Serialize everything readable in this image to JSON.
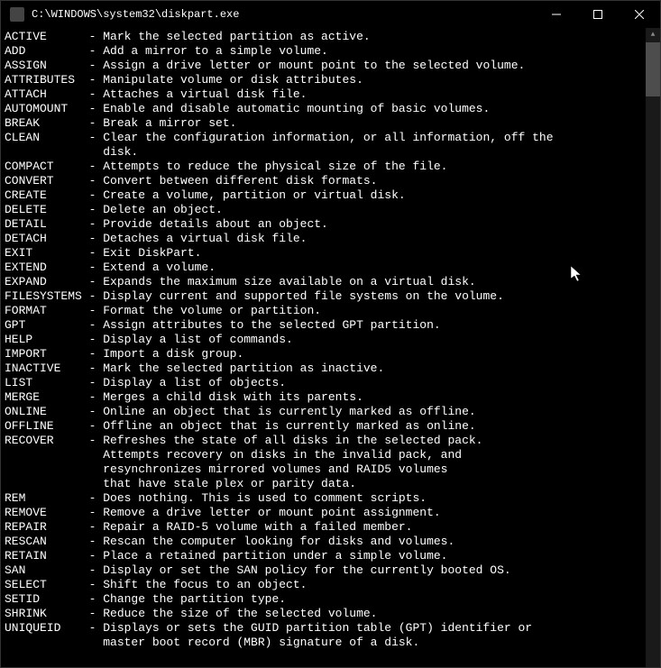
{
  "window": {
    "title": "C:\\WINDOWS\\system32\\diskpart.exe"
  },
  "commands": [
    {
      "name": "ACTIVE",
      "desc": "Mark the selected partition as active."
    },
    {
      "name": "ADD",
      "desc": "Add a mirror to a simple volume."
    },
    {
      "name": "ASSIGN",
      "desc": "Assign a drive letter or mount point to the selected volume."
    },
    {
      "name": "ATTRIBUTES",
      "desc": "Manipulate volume or disk attributes."
    },
    {
      "name": "ATTACH",
      "desc": "Attaches a virtual disk file."
    },
    {
      "name": "AUTOMOUNT",
      "desc": "Enable and disable automatic mounting of basic volumes."
    },
    {
      "name": "BREAK",
      "desc": "Break a mirror set."
    },
    {
      "name": "CLEAN",
      "desc": "Clear the configuration information, or all information, off the\n              disk."
    },
    {
      "name": "COMPACT",
      "desc": "Attempts to reduce the physical size of the file."
    },
    {
      "name": "CONVERT",
      "desc": "Convert between different disk formats."
    },
    {
      "name": "CREATE",
      "desc": "Create a volume, partition or virtual disk."
    },
    {
      "name": "DELETE",
      "desc": "Delete an object."
    },
    {
      "name": "DETAIL",
      "desc": "Provide details about an object."
    },
    {
      "name": "DETACH",
      "desc": "Detaches a virtual disk file."
    },
    {
      "name": "EXIT",
      "desc": "Exit DiskPart."
    },
    {
      "name": "EXTEND",
      "desc": "Extend a volume."
    },
    {
      "name": "EXPAND",
      "desc": "Expands the maximum size available on a virtual disk."
    },
    {
      "name": "FILESYSTEMS",
      "desc": "Display current and supported file systems on the volume."
    },
    {
      "name": "FORMAT",
      "desc": "Format the volume or partition."
    },
    {
      "name": "GPT",
      "desc": "Assign attributes to the selected GPT partition."
    },
    {
      "name": "HELP",
      "desc": "Display a list of commands."
    },
    {
      "name": "IMPORT",
      "desc": "Import a disk group."
    },
    {
      "name": "INACTIVE",
      "desc": "Mark the selected partition as inactive."
    },
    {
      "name": "LIST",
      "desc": "Display a list of objects."
    },
    {
      "name": "MERGE",
      "desc": "Merges a child disk with its parents."
    },
    {
      "name": "ONLINE",
      "desc": "Online an object that is currently marked as offline."
    },
    {
      "name": "OFFLINE",
      "desc": "Offline an object that is currently marked as online."
    },
    {
      "name": "RECOVER",
      "desc": "Refreshes the state of all disks in the selected pack.\n              Attempts recovery on disks in the invalid pack, and\n              resynchronizes mirrored volumes and RAID5 volumes\n              that have stale plex or parity data."
    },
    {
      "name": "REM",
      "desc": "Does nothing. This is used to comment scripts."
    },
    {
      "name": "REMOVE",
      "desc": "Remove a drive letter or mount point assignment."
    },
    {
      "name": "REPAIR",
      "desc": "Repair a RAID-5 volume with a failed member."
    },
    {
      "name": "RESCAN",
      "desc": "Rescan the computer looking for disks and volumes."
    },
    {
      "name": "RETAIN",
      "desc": "Place a retained partition under a simple volume."
    },
    {
      "name": "SAN",
      "desc": "Display or set the SAN policy for the currently booted OS."
    },
    {
      "name": "SELECT",
      "desc": "Shift the focus to an object."
    },
    {
      "name": "SETID",
      "desc": "Change the partition type."
    },
    {
      "name": "SHRINK",
      "desc": "Reduce the size of the selected volume."
    },
    {
      "name": "UNIQUEID",
      "desc": "Displays or sets the GUID partition table (GPT) identifier or\n              master boot record (MBR) signature of a disk."
    }
  ]
}
